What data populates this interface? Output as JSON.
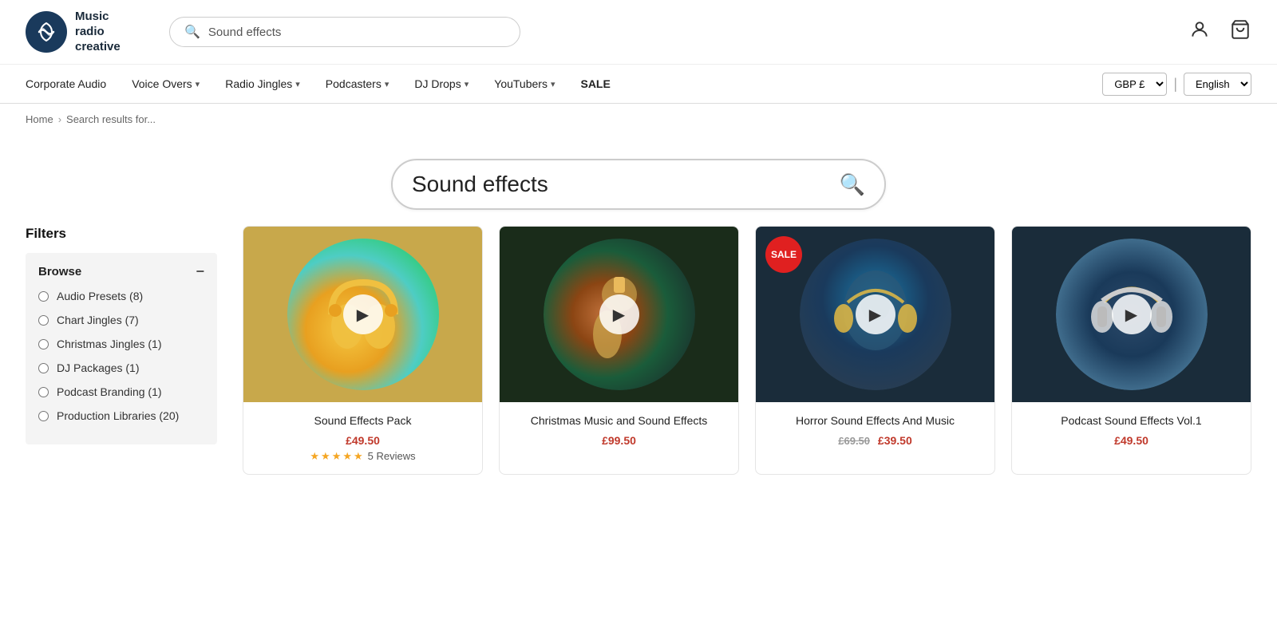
{
  "logo": {
    "name": "Music radio creative",
    "line1": "Music",
    "line2": "radio",
    "line3": "creative"
  },
  "header": {
    "search_placeholder": "Sound effects",
    "search_value": "Sound effects"
  },
  "nav": {
    "items": [
      {
        "label": "Corporate Audio",
        "has_dropdown": false
      },
      {
        "label": "Voice Overs",
        "has_dropdown": true
      },
      {
        "label": "Radio Jingles",
        "has_dropdown": true
      },
      {
        "label": "Podcasters",
        "has_dropdown": true
      },
      {
        "label": "DJ Drops",
        "has_dropdown": true
      },
      {
        "label": "YouTubers",
        "has_dropdown": true
      },
      {
        "label": "SALE",
        "has_dropdown": false
      }
    ],
    "currency": "GBP £",
    "language": "English"
  },
  "breadcrumb": {
    "home": "Home",
    "current": "Search results for..."
  },
  "search_hero": {
    "value": "Sound effects"
  },
  "filters": {
    "title": "Filters",
    "browse_label": "Browse",
    "items": [
      {
        "label": "Audio Presets (8)"
      },
      {
        "label": "Chart Jingles (7)"
      },
      {
        "label": "Christmas Jingles (1)"
      },
      {
        "label": "DJ Packages (1)"
      },
      {
        "label": "Podcast Branding (1)"
      },
      {
        "label": "Production Libraries (20)"
      }
    ]
  },
  "products": [
    {
      "name": "Sound Effects Pack",
      "price": "£49.50",
      "has_sale_badge": false,
      "stars": 5,
      "reviews": "5 Reviews",
      "has_original_price": false,
      "img_class": "img-1"
    },
    {
      "name": "Christmas Music and Sound Effects",
      "price": "£99.50",
      "has_sale_badge": false,
      "stars": 0,
      "reviews": "",
      "has_original_price": false,
      "img_class": "img-2"
    },
    {
      "name": "Horror Sound Effects And Music",
      "price": "£39.50",
      "original_price": "£69.50",
      "has_sale_badge": true,
      "stars": 0,
      "reviews": "",
      "has_original_price": true,
      "img_class": "img-3"
    },
    {
      "name": "Podcast Sound Effects Vol.1",
      "price": "£49.50",
      "has_sale_badge": false,
      "stars": 0,
      "reviews": "",
      "has_original_price": false,
      "img_class": "img-4"
    }
  ],
  "icons": {
    "search": "🔍",
    "user": "👤",
    "cart": "🛒",
    "play": "▶",
    "star": "★"
  }
}
